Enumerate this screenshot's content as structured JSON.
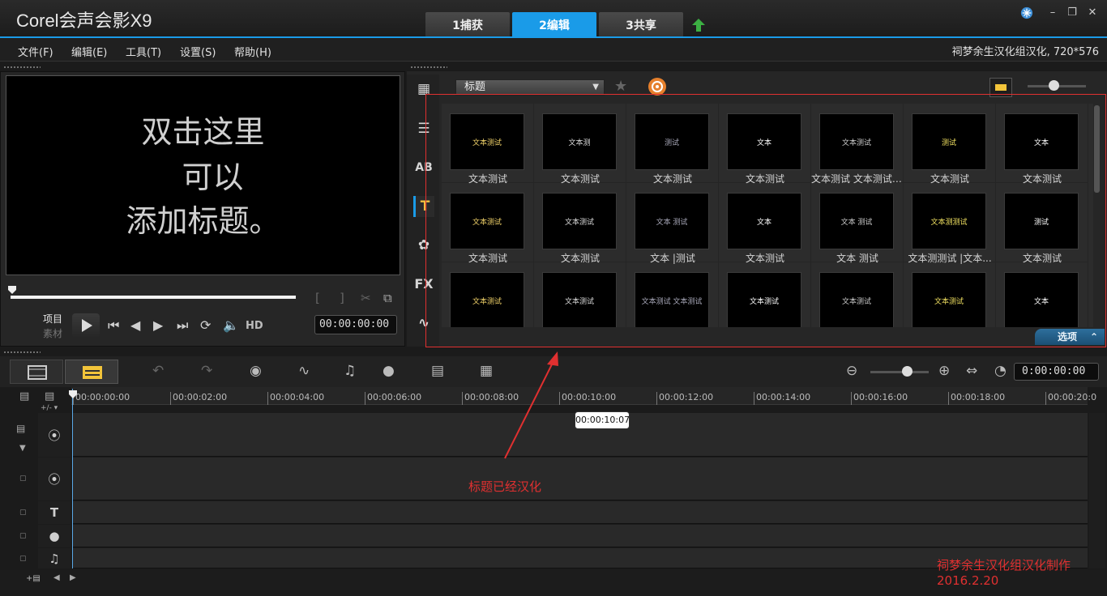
{
  "app": {
    "brand": "Corel会声会影X9"
  },
  "tabs": [
    {
      "label": "1捕获",
      "active": false
    },
    {
      "label": "2编辑",
      "active": true
    },
    {
      "label": "3共享",
      "active": false
    }
  ],
  "menu": [
    "文件(F)",
    "编辑(E)",
    "工具(T)",
    "设置(S)",
    "帮助(H)"
  ],
  "project_info": "祠梦余生汉化组汉化, 720*576",
  "preview": {
    "title_lines": [
      "双击这里",
      "可以",
      "添加标题。"
    ],
    "mode_project": "项目",
    "mode_clip": "素材",
    "hd_label": "HD",
    "timecode": "00:00:00:00"
  },
  "library": {
    "dropdown_value": "标题",
    "options_label": "选项",
    "items": [
      {
        "label": "文本测试",
        "thumb": "文本测试"
      },
      {
        "label": "文本测试",
        "thumb": "文本测"
      },
      {
        "label": "文本测试",
        "thumb": "测试"
      },
      {
        "label": "文本测试",
        "thumb": "文本"
      },
      {
        "label": "文本测试 文本测试 ...",
        "thumb": "文本测试"
      },
      {
        "label": "文本测试",
        "thumb": "测试"
      },
      {
        "label": "文本测试",
        "thumb": "文本"
      },
      {
        "label": "文本测试",
        "thumb": "文本测试"
      },
      {
        "label": "文本测试",
        "thumb": "文本测试"
      },
      {
        "label": "文本 |测试",
        "thumb": "文本 测试"
      },
      {
        "label": "文本测试",
        "thumb": "文本"
      },
      {
        "label": "文本 测试",
        "thumb": "文本 测试"
      },
      {
        "label": "文本测测试 |文本...",
        "thumb": "文本测测试"
      },
      {
        "label": "文本测试",
        "thumb": "测试"
      },
      {
        "label": "",
        "thumb": "文本测试"
      },
      {
        "label": "",
        "thumb": "文本测试"
      },
      {
        "label": "",
        "thumb": "文本测试 文本测试"
      },
      {
        "label": "",
        "thumb": "文本测试"
      },
      {
        "label": "",
        "thumb": "文本测试"
      },
      {
        "label": "",
        "thumb": "文本测试"
      },
      {
        "label": "",
        "thumb": "文本"
      }
    ]
  },
  "timeline": {
    "timecode": "0:00:00:00",
    "ticks": [
      "00:00:00:00",
      "00:00:02:00",
      "00:00:04:00",
      "00:00:06:00",
      "00:00:08:00",
      "00:00:10:00",
      "00:00:12:00",
      "00:00:14:00",
      "00:00:16:00",
      "00:00:18:00",
      "00:00:20:0"
    ],
    "tooltip": "00:00:10:07",
    "track_icons": [
      "video-track-icon",
      "overlay-track-icon",
      "title-track-icon",
      "voice-track-icon",
      "music-track-icon"
    ]
  },
  "annotations": {
    "arrow_note": "标题已经汉化",
    "credit_line1": "祠梦余生汉化组汉化制作",
    "credit_line2": "2016.2.20",
    "color": "#e03030"
  },
  "colors": {
    "accent": "#1a9be8",
    "annotation": "#e03030"
  }
}
